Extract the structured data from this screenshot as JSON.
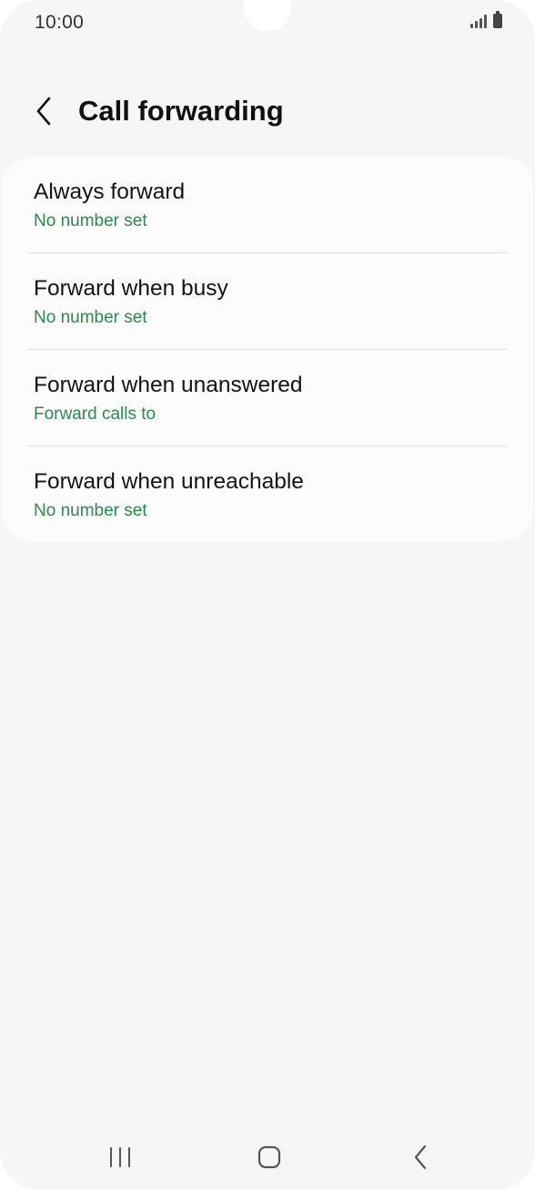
{
  "status_bar": {
    "time": "10:00",
    "icons": [
      "signal-icon",
      "battery-icon"
    ]
  },
  "header": {
    "back_icon": "chevron-left-icon",
    "title": "Call forwarding"
  },
  "options": [
    {
      "title": "Always forward",
      "subtitle": "No number set"
    },
    {
      "title": "Forward when busy",
      "subtitle": "No number set"
    },
    {
      "title": "Forward when unanswered",
      "subtitle": "Forward calls to"
    },
    {
      "title": "Forward when unreachable",
      "subtitle": "No number set"
    }
  ],
  "nav_bar": {
    "icons": [
      "recents-icon",
      "home-icon",
      "back-icon"
    ]
  },
  "colors": {
    "background": "#f6f6f8",
    "card": "#fcfcfd",
    "accent_green": "#2a8a4e",
    "text": "#141414"
  }
}
